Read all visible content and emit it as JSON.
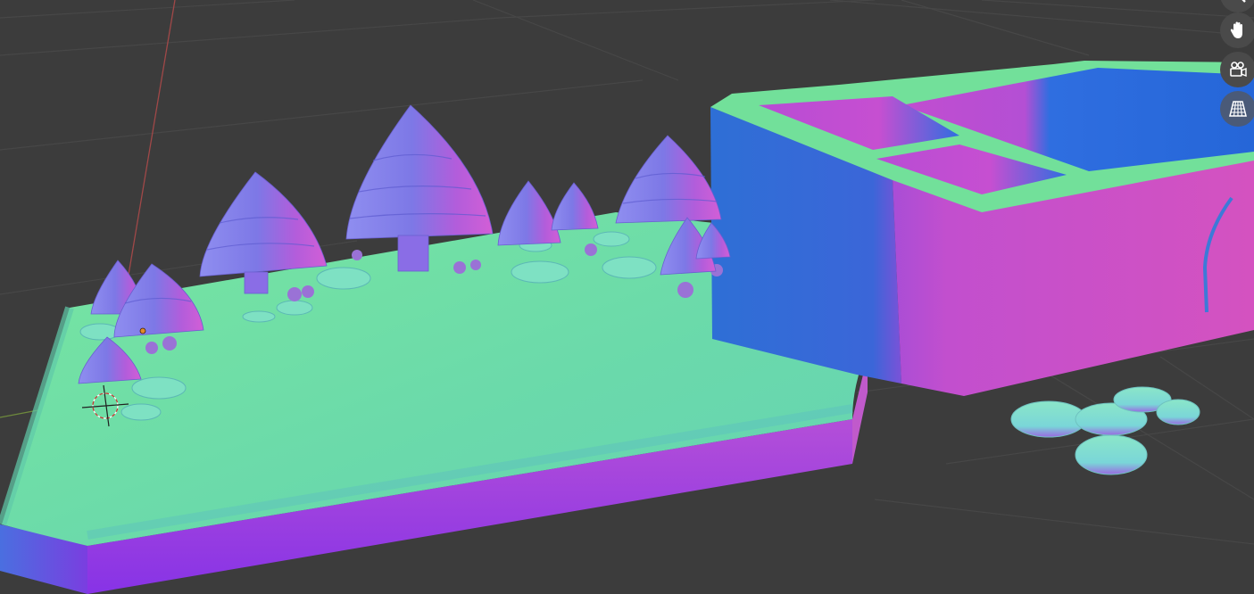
{
  "app": {
    "kind": "3D viewport",
    "shading": "normal-map"
  },
  "navigation": {
    "buttons": [
      {
        "icon": "zoom-icon"
      },
      {
        "icon": "hand-pan-icon"
      },
      {
        "icon": "camera-icon"
      },
      {
        "icon": "perspective-grid-icon",
        "active": true
      }
    ]
  },
  "colors": {
    "background": "#3c3c3c",
    "grid_line": "#474747",
    "axis_x": "#a04848",
    "axis_y": "#6e8a3c",
    "top_face": "#6fe0a6",
    "side_magenta": "#c04bd2",
    "side_violet": "#8a3ee0",
    "side_blue": "#2f6fd8"
  }
}
